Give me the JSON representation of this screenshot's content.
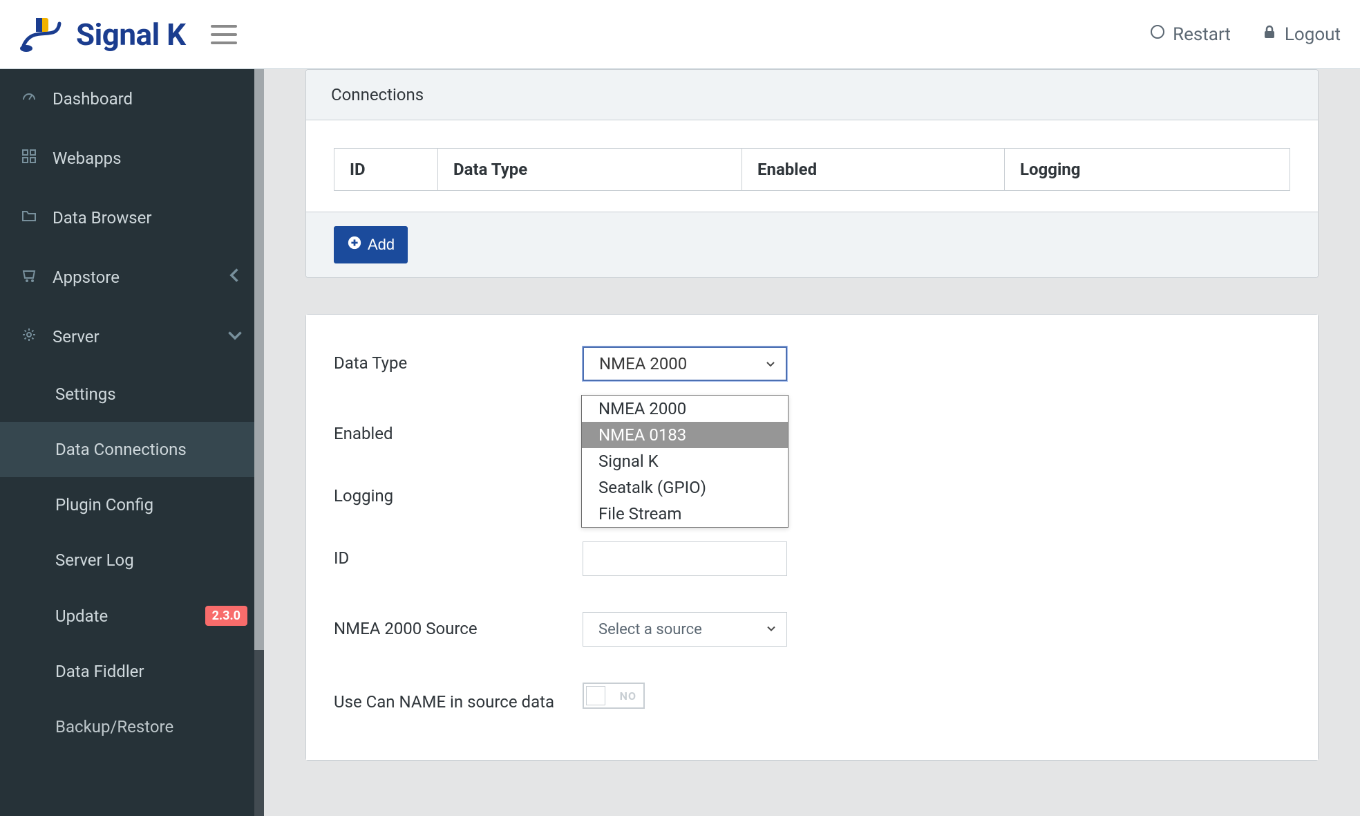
{
  "brand": {
    "text": "Signal K"
  },
  "header": {
    "restart": "Restart",
    "logout": "Logout"
  },
  "sidebar": {
    "dashboard": "Dashboard",
    "webapps": "Webapps",
    "data_browser": "Data Browser",
    "appstore": "Appstore",
    "server": "Server",
    "settings": "Settings",
    "data_connections": "Data Connections",
    "plugin_config": "Plugin Config",
    "server_log": "Server Log",
    "update": {
      "label": "Update",
      "badge": "2.3.0"
    },
    "data_fiddler": "Data Fiddler",
    "backup_restore": "Backup/Restore"
  },
  "connections_card": {
    "title": "Connections",
    "cols": {
      "id": "ID",
      "data_type": "Data Type",
      "enabled": "Enabled",
      "logging": "Logging"
    },
    "add_label": "Add"
  },
  "form": {
    "labels": {
      "data_type": "Data Type",
      "enabled": "Enabled",
      "logging": "Logging",
      "id": "ID",
      "source": "NMEA 2000 Source",
      "use_can": "Use Can NAME in source data"
    },
    "data_type": {
      "selected": "NMEA 2000",
      "options": [
        "NMEA 2000",
        "NMEA 0183",
        "Signal K",
        "Seatalk (GPIO)",
        "File Stream"
      ],
      "highlighted_index": 1
    },
    "source_placeholder": "Select a source",
    "toggle_no": "NO"
  }
}
